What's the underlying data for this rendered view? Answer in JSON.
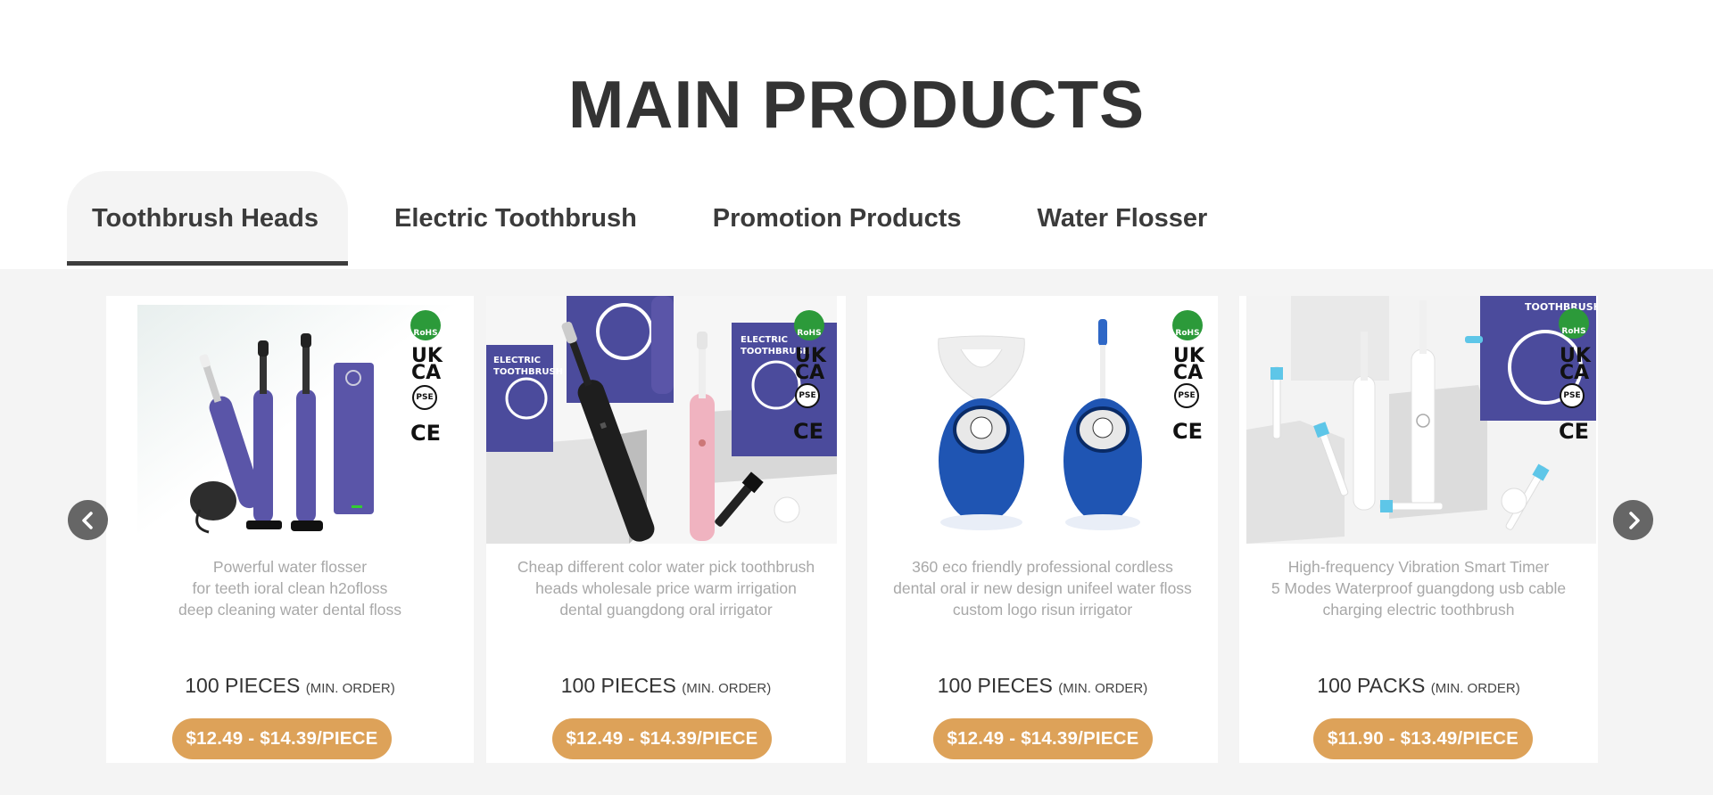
{
  "section": {
    "title": "MAIN PRODUCTS"
  },
  "tabs": [
    {
      "label": "Toothbrush Heads",
      "active": true
    },
    {
      "label": "Electric Toothbrush",
      "active": false
    },
    {
      "label": "Promotion Products",
      "active": false
    },
    {
      "label": "Water Flosser",
      "active": false
    }
  ],
  "carousel": {
    "prev_icon": "chevron-left-icon",
    "next_icon": "chevron-right-icon"
  },
  "products": [
    {
      "description": "Powerful water flosser\nfor teeth ioral clean h2ofloss\ndeep cleaning water dental floss",
      "moq_qty": "100 PIECES",
      "moq_note": "(MIN. ORDER)",
      "price": "$12.49 - $14.39/PIECE"
    },
    {
      "description": "Cheap different color water pick toothbrush\nheads wholesale price warm irrigation\ndental guangdong oral irrigator",
      "moq_qty": "100 PIECES",
      "moq_note": "(MIN. ORDER)",
      "price": "$12.49 - $14.39/PIECE"
    },
    {
      "description": "360 eco friendly professional cordless\ndental oral ir new design unifeel water floss\ncustom logo risun irrigator",
      "moq_qty": "100 PIECES",
      "moq_note": "(MIN. ORDER)",
      "price": "$12.49 - $14.39/PIECE"
    },
    {
      "description": "High-frequency Vibration Smart Timer\n5 Modes Waterproof guangdong usb cable\ncharging electric toothbrush",
      "moq_qty": "100 PACKS",
      "moq_note": "(MIN. ORDER)",
      "price": "$11.90 - $13.49/PIECE"
    }
  ],
  "certifications": {
    "rohs": "RoHS",
    "ukca_1": "UK",
    "ukca_2": "CA",
    "pse": "PSE",
    "ce": "CE"
  },
  "colors": {
    "price_button": "#dda259",
    "tab_underline": "#3d3d3d",
    "gallery_bg": "#f4f4f4",
    "arrow_bg": "#666666"
  }
}
